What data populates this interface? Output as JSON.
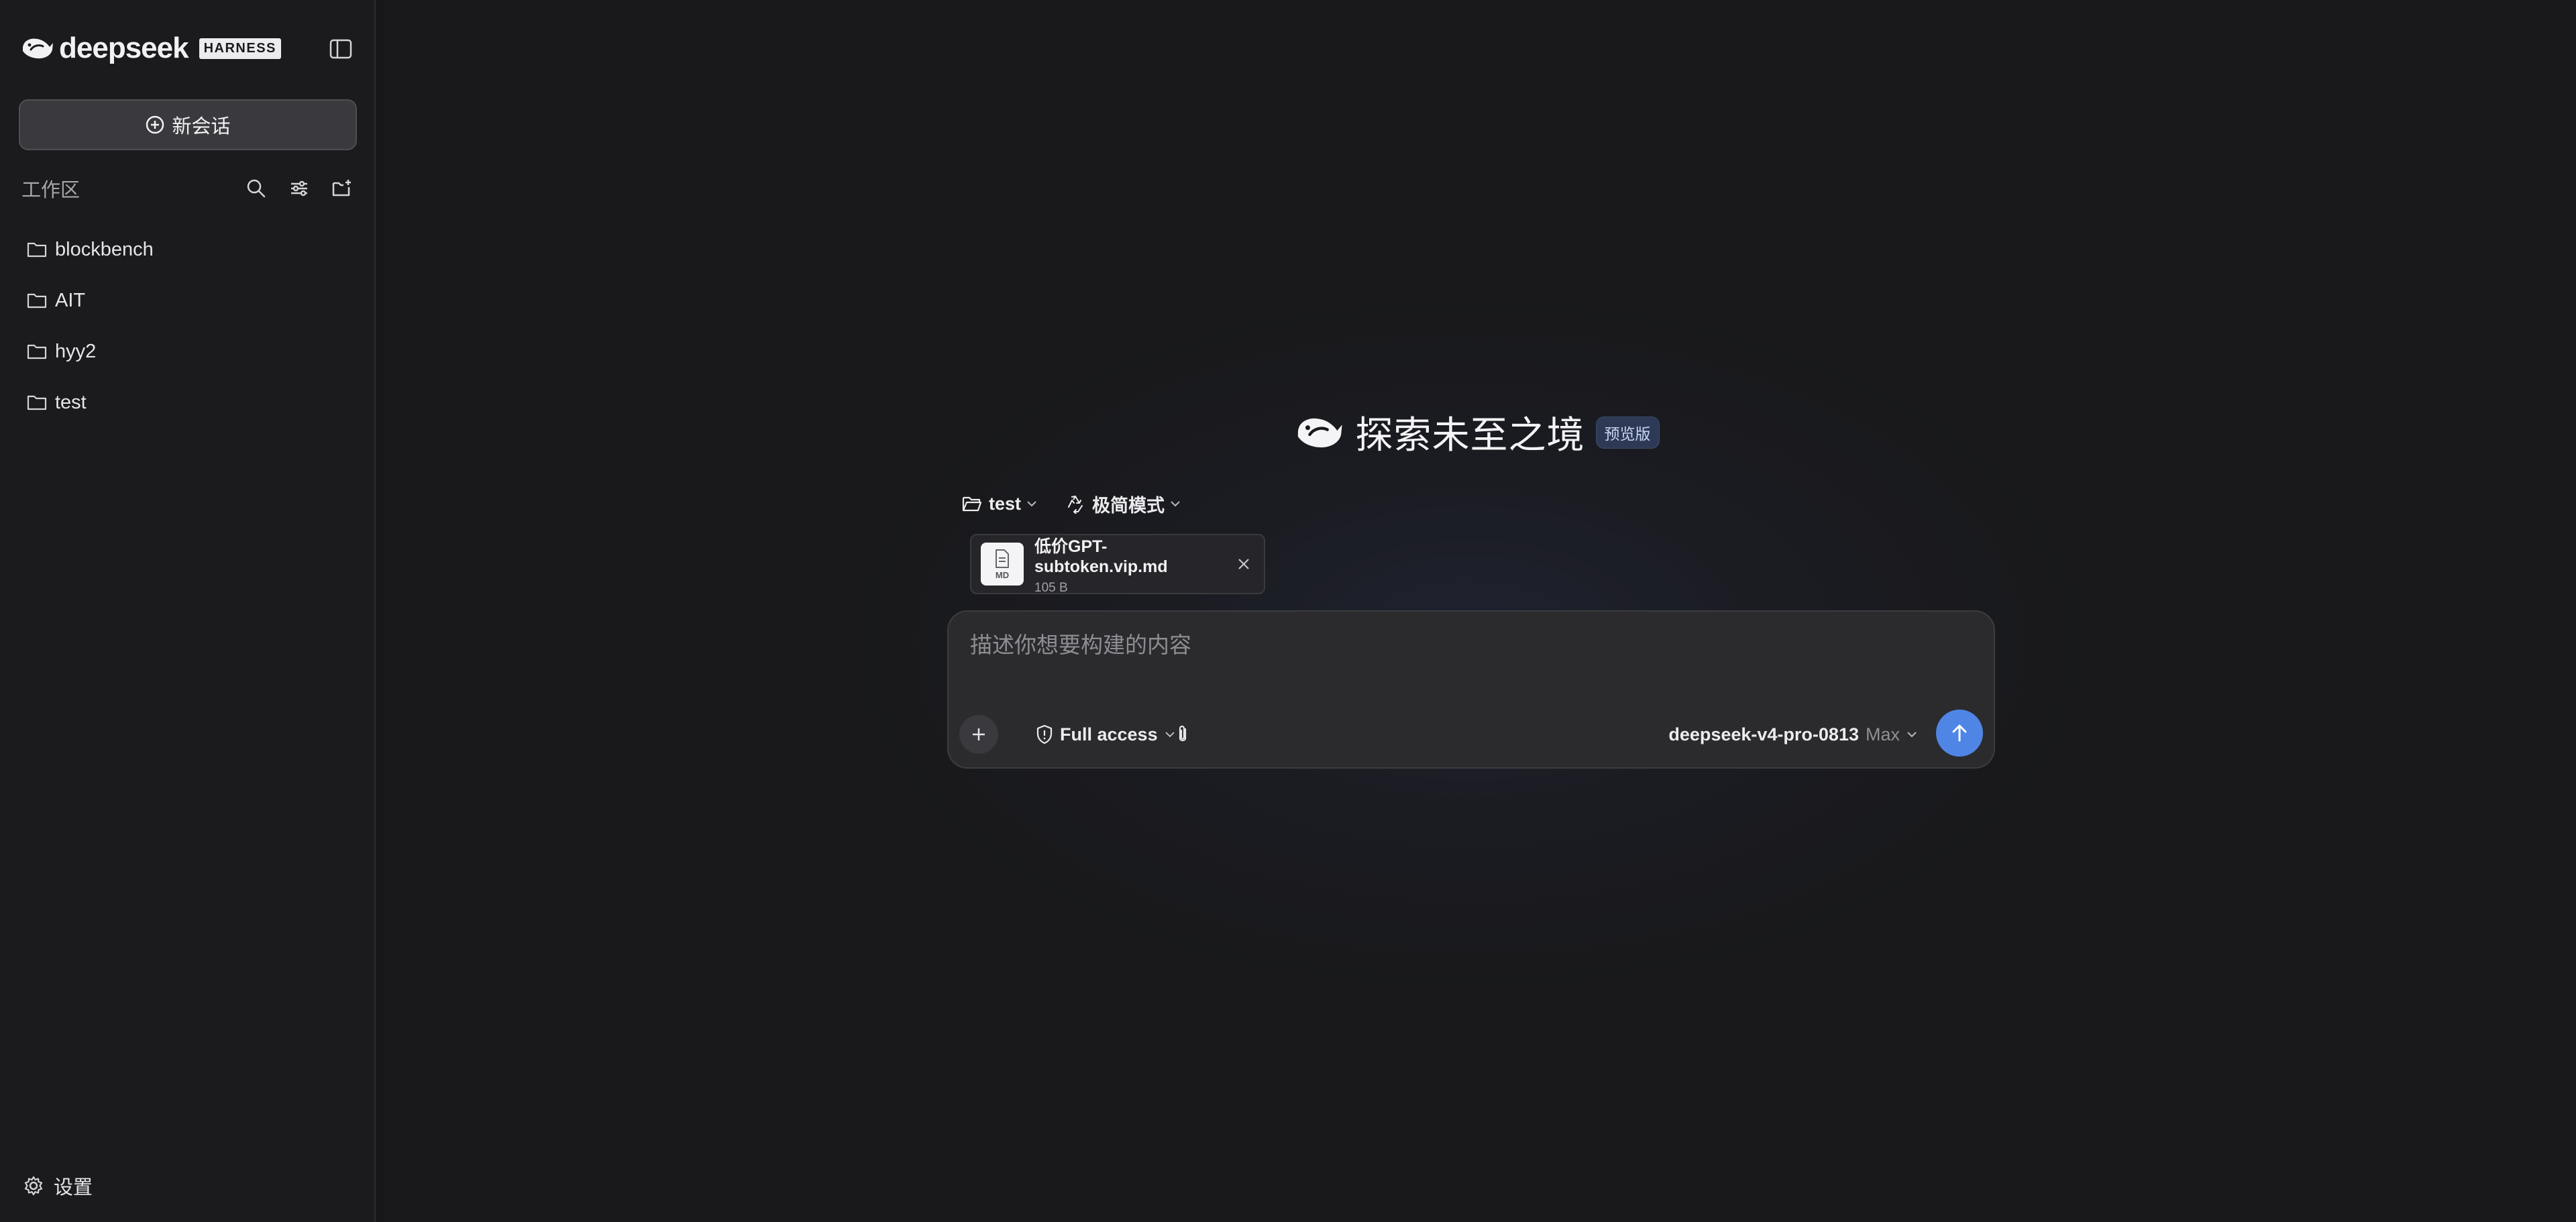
{
  "brand": {
    "name": "deepseek",
    "badge": "HARNESS"
  },
  "sidebar": {
    "new_chat_label": "新会话",
    "workspace_title": "工作区",
    "workspaces": [
      {
        "label": "blockbench"
      },
      {
        "label": "AIT"
      },
      {
        "label": "hyy2"
      },
      {
        "label": "test"
      }
    ],
    "settings_label": "设置"
  },
  "hero": {
    "title": "探索未至之境",
    "badge": "预览版"
  },
  "selectors": {
    "folder_label": "test",
    "mode_label": "极简模式"
  },
  "attachment": {
    "file_name": "低价GPT-subtoken.vip.md",
    "file_size": "105 B",
    "file_type": "MD"
  },
  "composer": {
    "placeholder": "描述你想要构建的内容",
    "value": "",
    "access_label": "Full access",
    "model_name": "deepseek-v4-pro-0813",
    "model_level": "Max"
  },
  "colors": {
    "accent": "#4f86e6",
    "background": "#18181a",
    "sidebar": "#1b1b1d",
    "badge_bg": "#2e3a55"
  }
}
